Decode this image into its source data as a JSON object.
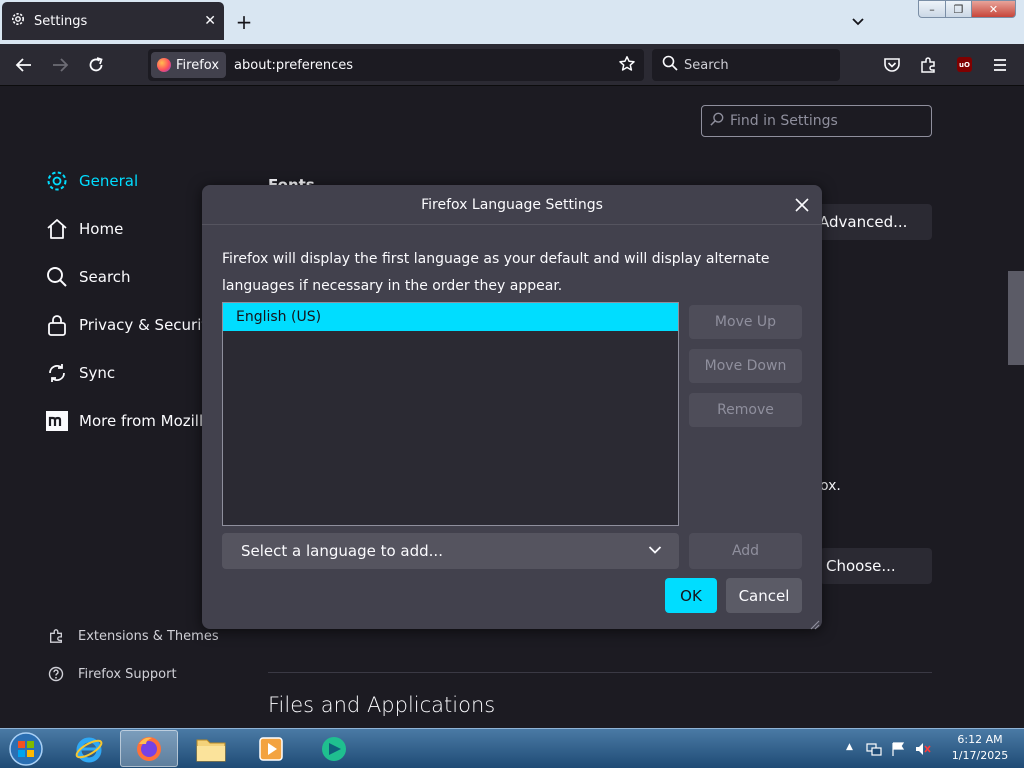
{
  "browser": {
    "tab_title": "Settings",
    "identity_label": "Firefox",
    "url": "about:preferences",
    "search_placeholder": "Search",
    "ublock_label": "uO"
  },
  "sidebar": {
    "items": [
      {
        "label": "General",
        "icon": "gear-icon",
        "selected": true
      },
      {
        "label": "Home",
        "icon": "home-icon"
      },
      {
        "label": "Search",
        "icon": "search-icon"
      },
      {
        "label": "Privacy & Security",
        "icon": "lock-icon"
      },
      {
        "label": "Sync",
        "icon": "sync-icon"
      },
      {
        "label": "More from Mozilla",
        "icon": "mozilla-m-icon"
      }
    ],
    "footer": [
      {
        "label": "Extensions & Themes",
        "icon": "puzzle-icon"
      },
      {
        "label": "Firefox Support",
        "icon": "help-icon"
      }
    ]
  },
  "settings_page": {
    "find_placeholder": "Find in Settings",
    "fonts_heading": "Fonts",
    "advanced_button": "Advanced...",
    "partial_text": "ox.",
    "choose_button": "Choose...",
    "files_heading": "Files and Applications"
  },
  "dialog": {
    "title": "Firefox Language Settings",
    "description": "Firefox will display the first language as your default and will display alternate languages if necessary in the order they appear.",
    "languages": [
      "English (US)"
    ],
    "move_up": "Move Up",
    "move_down": "Move Down",
    "remove": "Remove",
    "select_placeholder": "Select a language to add...",
    "add": "Add",
    "ok": "OK",
    "cancel": "Cancel"
  },
  "taskbar": {
    "time": "6:12 AM",
    "date": "1/17/2025"
  },
  "colors": {
    "accent": "#00ddff",
    "page_bg": "#1c1b22",
    "dialog_bg": "#42414d"
  }
}
